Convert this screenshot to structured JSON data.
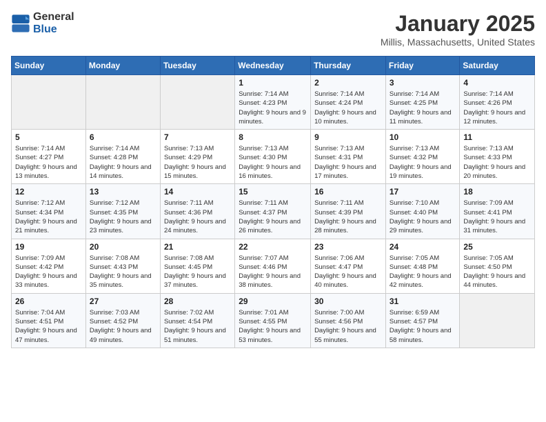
{
  "header": {
    "logo_general": "General",
    "logo_blue": "Blue",
    "title": "January 2025",
    "subtitle": "Millis, Massachusetts, United States"
  },
  "weekdays": [
    "Sunday",
    "Monday",
    "Tuesday",
    "Wednesday",
    "Thursday",
    "Friday",
    "Saturday"
  ],
  "weeks": [
    [
      {
        "day": "",
        "info": ""
      },
      {
        "day": "",
        "info": ""
      },
      {
        "day": "",
        "info": ""
      },
      {
        "day": "1",
        "info": "Sunrise: 7:14 AM\nSunset: 4:23 PM\nDaylight: 9 hours and 9 minutes."
      },
      {
        "day": "2",
        "info": "Sunrise: 7:14 AM\nSunset: 4:24 PM\nDaylight: 9 hours and 10 minutes."
      },
      {
        "day": "3",
        "info": "Sunrise: 7:14 AM\nSunset: 4:25 PM\nDaylight: 9 hours and 11 minutes."
      },
      {
        "day": "4",
        "info": "Sunrise: 7:14 AM\nSunset: 4:26 PM\nDaylight: 9 hours and 12 minutes."
      }
    ],
    [
      {
        "day": "5",
        "info": "Sunrise: 7:14 AM\nSunset: 4:27 PM\nDaylight: 9 hours and 13 minutes."
      },
      {
        "day": "6",
        "info": "Sunrise: 7:14 AM\nSunset: 4:28 PM\nDaylight: 9 hours and 14 minutes."
      },
      {
        "day": "7",
        "info": "Sunrise: 7:13 AM\nSunset: 4:29 PM\nDaylight: 9 hours and 15 minutes."
      },
      {
        "day": "8",
        "info": "Sunrise: 7:13 AM\nSunset: 4:30 PM\nDaylight: 9 hours and 16 minutes."
      },
      {
        "day": "9",
        "info": "Sunrise: 7:13 AM\nSunset: 4:31 PM\nDaylight: 9 hours and 17 minutes."
      },
      {
        "day": "10",
        "info": "Sunrise: 7:13 AM\nSunset: 4:32 PM\nDaylight: 9 hours and 19 minutes."
      },
      {
        "day": "11",
        "info": "Sunrise: 7:13 AM\nSunset: 4:33 PM\nDaylight: 9 hours and 20 minutes."
      }
    ],
    [
      {
        "day": "12",
        "info": "Sunrise: 7:12 AM\nSunset: 4:34 PM\nDaylight: 9 hours and 21 minutes."
      },
      {
        "day": "13",
        "info": "Sunrise: 7:12 AM\nSunset: 4:35 PM\nDaylight: 9 hours and 23 minutes."
      },
      {
        "day": "14",
        "info": "Sunrise: 7:11 AM\nSunset: 4:36 PM\nDaylight: 9 hours and 24 minutes."
      },
      {
        "day": "15",
        "info": "Sunrise: 7:11 AM\nSunset: 4:37 PM\nDaylight: 9 hours and 26 minutes."
      },
      {
        "day": "16",
        "info": "Sunrise: 7:11 AM\nSunset: 4:39 PM\nDaylight: 9 hours and 28 minutes."
      },
      {
        "day": "17",
        "info": "Sunrise: 7:10 AM\nSunset: 4:40 PM\nDaylight: 9 hours and 29 minutes."
      },
      {
        "day": "18",
        "info": "Sunrise: 7:09 AM\nSunset: 4:41 PM\nDaylight: 9 hours and 31 minutes."
      }
    ],
    [
      {
        "day": "19",
        "info": "Sunrise: 7:09 AM\nSunset: 4:42 PM\nDaylight: 9 hours and 33 minutes."
      },
      {
        "day": "20",
        "info": "Sunrise: 7:08 AM\nSunset: 4:43 PM\nDaylight: 9 hours and 35 minutes."
      },
      {
        "day": "21",
        "info": "Sunrise: 7:08 AM\nSunset: 4:45 PM\nDaylight: 9 hours and 37 minutes."
      },
      {
        "day": "22",
        "info": "Sunrise: 7:07 AM\nSunset: 4:46 PM\nDaylight: 9 hours and 38 minutes."
      },
      {
        "day": "23",
        "info": "Sunrise: 7:06 AM\nSunset: 4:47 PM\nDaylight: 9 hours and 40 minutes."
      },
      {
        "day": "24",
        "info": "Sunrise: 7:05 AM\nSunset: 4:48 PM\nDaylight: 9 hours and 42 minutes."
      },
      {
        "day": "25",
        "info": "Sunrise: 7:05 AM\nSunset: 4:50 PM\nDaylight: 9 hours and 44 minutes."
      }
    ],
    [
      {
        "day": "26",
        "info": "Sunrise: 7:04 AM\nSunset: 4:51 PM\nDaylight: 9 hours and 47 minutes."
      },
      {
        "day": "27",
        "info": "Sunrise: 7:03 AM\nSunset: 4:52 PM\nDaylight: 9 hours and 49 minutes."
      },
      {
        "day": "28",
        "info": "Sunrise: 7:02 AM\nSunset: 4:54 PM\nDaylight: 9 hours and 51 minutes."
      },
      {
        "day": "29",
        "info": "Sunrise: 7:01 AM\nSunset: 4:55 PM\nDaylight: 9 hours and 53 minutes."
      },
      {
        "day": "30",
        "info": "Sunrise: 7:00 AM\nSunset: 4:56 PM\nDaylight: 9 hours and 55 minutes."
      },
      {
        "day": "31",
        "info": "Sunrise: 6:59 AM\nSunset: 4:57 PM\nDaylight: 9 hours and 58 minutes."
      },
      {
        "day": "",
        "info": ""
      }
    ]
  ]
}
